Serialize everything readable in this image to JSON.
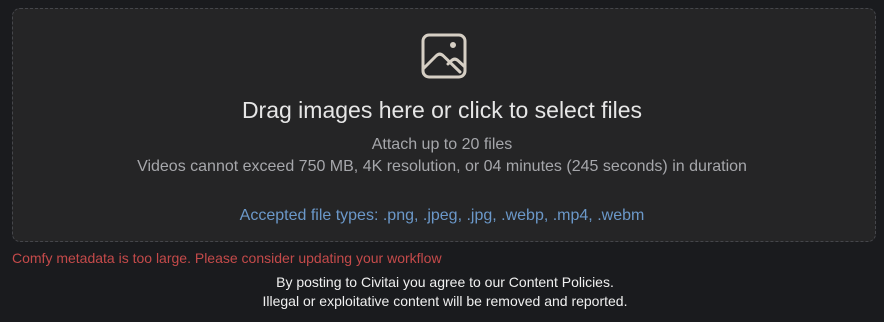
{
  "dropzone": {
    "icon": "photo-icon",
    "title": "Drag images here or click to select files",
    "attach_limit": "Attach up to 20 files",
    "video_limits": "Videos cannot exceed 750 MB, 4K resolution, or 04 minutes (245 seconds) in duration",
    "accepted_types": "Accepted file types: .png, .jpeg, .jpg, .webp, .mp4, .webm"
  },
  "error": {
    "message": "Comfy metadata is too large. Please consider updating your workflow"
  },
  "notice": {
    "line1": "By posting to Civitai you agree to our Content Policies.",
    "line2": "Illegal or exploitative content will be removed and reported."
  },
  "colors": {
    "background": "#1a1b1e",
    "dropzone_bg": "#252526",
    "accent_blue": "#6b98c9",
    "error_red": "#c44a4a"
  }
}
